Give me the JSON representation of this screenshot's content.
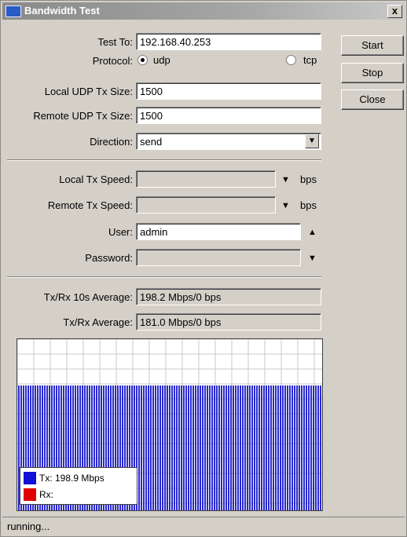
{
  "window": {
    "title": "Bandwidth Test",
    "close_glyph": "x"
  },
  "buttons": {
    "start": "Start",
    "stop": "Stop",
    "close": "Close"
  },
  "form": {
    "test_to": {
      "label": "Test To:",
      "value": "192.168.40.253"
    },
    "protocol": {
      "label": "Protocol:",
      "options": [
        {
          "label": "udp",
          "selected": true
        },
        {
          "label": "tcp",
          "selected": false
        }
      ]
    },
    "local_udp_tx_size": {
      "label": "Local UDP Tx Size:",
      "value": "1500"
    },
    "remote_udp_tx_size": {
      "label": "Remote UDP Tx Size:",
      "value": "1500"
    },
    "direction": {
      "label": "Direction:",
      "value": "send",
      "icon": "dropdown-arrow-icon"
    }
  },
  "speed": {
    "local_tx_speed": {
      "label": "Local Tx Speed:",
      "value": "",
      "unit": "bps"
    },
    "remote_tx_speed": {
      "label": "Remote Tx Speed:",
      "value": "",
      "unit": "bps"
    },
    "user": {
      "label": "User:",
      "value": "admin"
    },
    "password": {
      "label": "Password:",
      "value": ""
    }
  },
  "stats": {
    "avg10": {
      "label": "Tx/Rx 10s Average:",
      "value": "198.2 Mbps/0 bps"
    },
    "avg": {
      "label": "Tx/Rx Average:",
      "value": "181.0 Mbps/0 bps"
    }
  },
  "graph": {
    "legend": [
      {
        "label": "Tx:  198.9 Mbps",
        "color": "#1010d8"
      },
      {
        "label": "Rx:",
        "color": "#e00000"
      }
    ],
    "bar_color": "#2a2ad0",
    "fill_level": 0.73
  },
  "status": {
    "text": "running..."
  }
}
